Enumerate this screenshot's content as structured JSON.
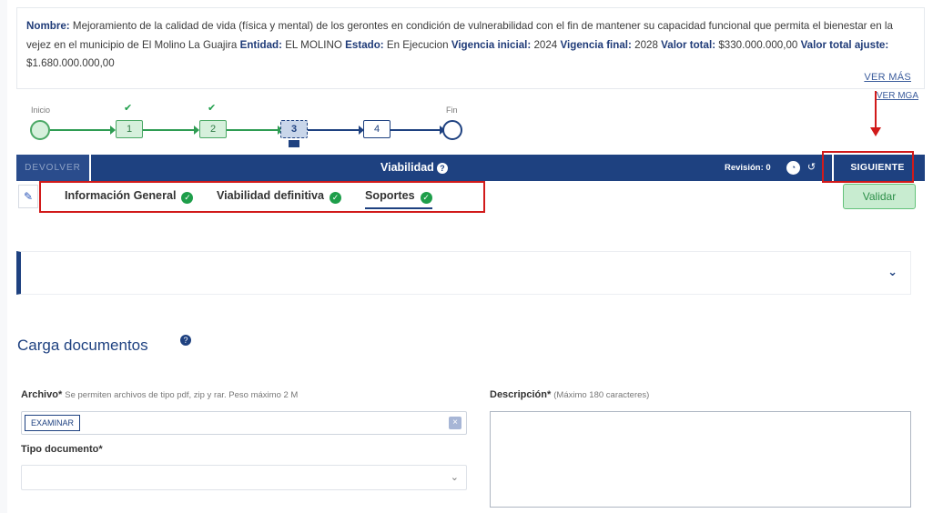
{
  "project": {
    "nombre_label": "Nombre:",
    "nombre": "Mejoramiento de la calidad de vida (física y mental) de los gerontes en condición de vulnerabilidad con el fin de mantener su capacidad funcional que permita el bienestar en la vejez en el municipio de El Molino La Guajira",
    "entidad_label": "Entidad:",
    "entidad": "EL MOLINO",
    "estado_label": "Estado:",
    "estado": "En Ejecucion",
    "vig_ini_label": "Vigencia inicial:",
    "vig_ini": "2024",
    "vig_fin_label": "Vigencia final:",
    "vig_fin": "2028",
    "valor_label": "Valor total:",
    "valor": "$330.000.000,00",
    "valor_ajuste_label": "Valor total ajuste:",
    "valor_ajuste": "$1.680.000.000,00"
  },
  "links": {
    "ver_mas": "VER MÁS",
    "ver_mga": "VER MGA"
  },
  "stepper": {
    "start_label": "Inicio",
    "end_label": "Fin",
    "steps": [
      "1",
      "2",
      "3",
      "4"
    ]
  },
  "bar": {
    "devolver": "DEVOLVER",
    "title": "Viabilidad",
    "revision": "Revisión: 0",
    "siguiente": "SIGUIENTE"
  },
  "tabs": [
    "Información General",
    "Viabilidad definitiva",
    "Soportes"
  ],
  "validar": "Validar",
  "carga": {
    "title": "Carga documentos",
    "archivo_label": "Archivo*",
    "archivo_hint": "Se permiten archivos de tipo pdf, zip y rar. Peso máximo 2 M",
    "examinar": "EXAMINAR",
    "tipo_label": "Tipo documento*",
    "descripcion_label": "Descripción*",
    "descripcion_hint": "(Máximo 180 caracteres)"
  },
  "colors": {
    "primary": "#1e4180",
    "success": "#1e9e4a",
    "highlight": "#d11a1a"
  }
}
